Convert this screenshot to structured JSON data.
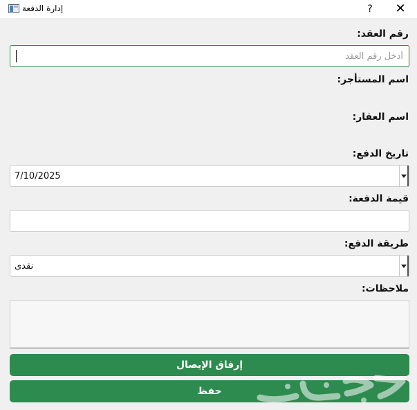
{
  "window": {
    "title": "إدارة الدفعة",
    "help_label": "?",
    "close_label": "✕"
  },
  "form": {
    "contract_number_label": "رقم العقد:",
    "contract_number_value": "",
    "contract_number_placeholder": "أدخل رقم العقد",
    "tenant_name_label": "اسم المستأجر:",
    "property_name_label": "اسم العقار:",
    "payment_date_label": "تاريخ الدفع:",
    "payment_date_value": "7/10/2025",
    "payment_amount_label": "قيمة الدفعة:",
    "payment_amount_value": "",
    "payment_method_label": "طريقة الدفع:",
    "payment_method_value": "نقدى",
    "notes_label": "ملاحظات:"
  },
  "buttons": {
    "attach_receipt": "إرفاق الإيصال",
    "save": "حفظ"
  },
  "colors": {
    "button_green": "#2e8b4f",
    "focus_border": "#2f7a3a"
  }
}
